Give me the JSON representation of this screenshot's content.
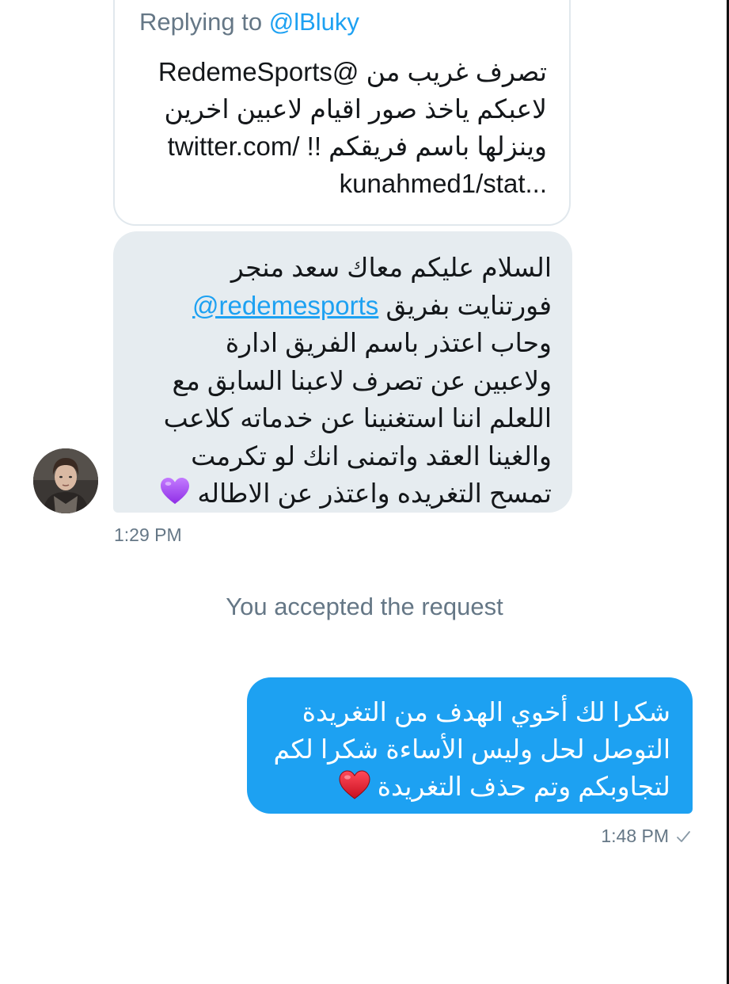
{
  "quoted_tweet": {
    "replying_prefix": "Replying to",
    "replying_handle": "@lBluky",
    "lines": [
      "RedemeSports@ تصرف غريب من",
      "لاعبكم ياخذ صور اقيام لاعبين اخرين",
      "وينزلها باسم فريقكم !! /twitter.com",
      "kunahmed1/stat..."
    ]
  },
  "received_message": {
    "line1": "السلام عليكم معاك سعد منجر",
    "line2_text": "فورتنايت بفريق",
    "line2_mention": "@redemesports",
    "line3": "وحاب اعتذر باسم الفريق ادارة",
    "line4": "ولاعبين عن تصرف لاعبنا السابق مع",
    "line5": "اللعلم اننا استغنينا عن خدماته كلاعب",
    "line6": "والغينا العقد واتمنى انك لو تكرمت",
    "line7": "تمسح التغريده واعتذر عن الاطاله",
    "emoji": "purple-heart-icon",
    "timestamp": "1:29 PM"
  },
  "system_message": "You accepted the request",
  "sent_message": {
    "line1": "شكرا لك أخوي الهدف من التغريدة",
    "line2": "التوصل لحل وليس الأساءة شكرا لكم",
    "line3": "لتجاوبكم وتم حذف التغريدة",
    "emoji": "red-heart-icon",
    "timestamp": "1:48 PM",
    "status_icon": "check-icon"
  },
  "colors": {
    "accent": "#1da1f2",
    "received_bubble": "#e6ecf0",
    "meta_text": "#657786",
    "body_text": "#14171a",
    "purple_heart": "#a64bf4",
    "red_heart": "#e0152b"
  }
}
